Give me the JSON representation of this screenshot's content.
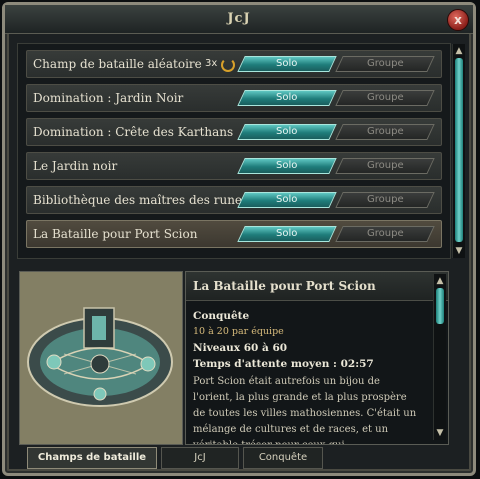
{
  "window": {
    "title": "JcJ",
    "close_label": "x"
  },
  "battlegrounds": {
    "solo_label": "Solo",
    "group_label": "Groupe",
    "items": [
      {
        "name": "Champ de bataille aléatoire",
        "repeat": "3x"
      },
      {
        "name": "Domination : Jardin Noir"
      },
      {
        "name": "Domination : Crête des Karthans"
      },
      {
        "name": "Le Jardin noir"
      },
      {
        "name": "Bibliothèque des maîtres des runes"
      },
      {
        "name": "La Bataille pour Port Scion"
      }
    ],
    "selected_index": 5
  },
  "details": {
    "title": "La Bataille pour Port Scion",
    "mode": "Conquête",
    "team_size": "10 à 20 par équipe",
    "levels": "Niveaux 60 à 60",
    "wait_time": "Temps d'attente moyen : 02:57",
    "description": "Port Scion était autrefois un bijou de l'orient, la plus grande et la plus prospère de toutes les villes mathosiennes. C'était un mélange de cultures et de races, et un véritable trésor pour ceux qui"
  },
  "tabs": [
    "Champs de bataille",
    "JcJ",
    "Conquête"
  ],
  "active_tab": 0,
  "colors": {
    "accent_teal": "#2a9a93",
    "frame": "#8d8a7c",
    "close_red": "#b0322a"
  }
}
